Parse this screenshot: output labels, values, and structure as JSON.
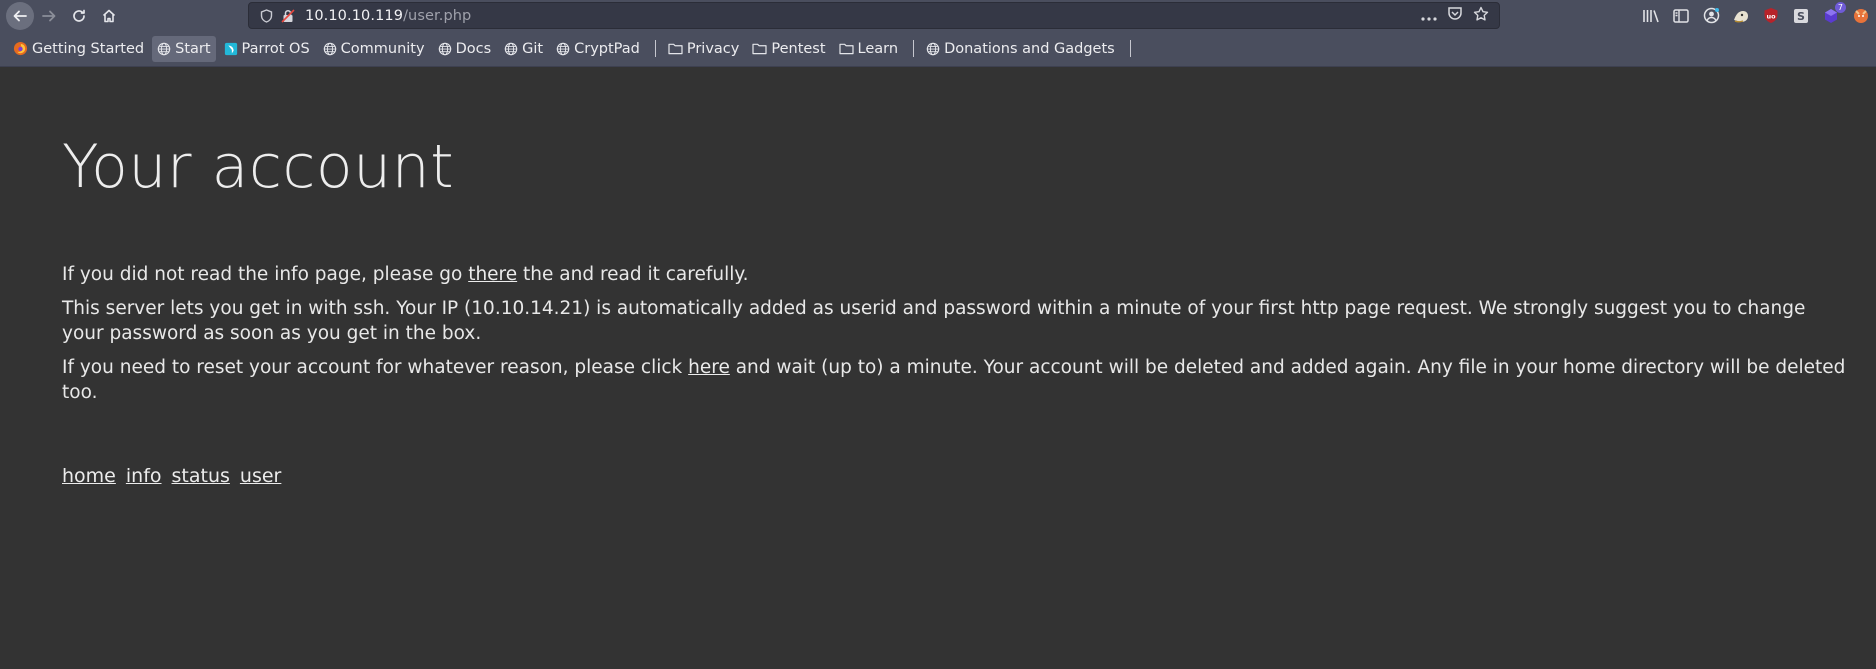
{
  "browser": {
    "url_host": "10.10.10.119",
    "url_path": "/user.php",
    "bookmarks": [
      {
        "label": "Getting Started",
        "icon": "firefox-icon"
      },
      {
        "label": "Start",
        "icon": "globe-icon",
        "active": true
      },
      {
        "label": "Parrot OS",
        "icon": "parrot-icon"
      },
      {
        "label": "Community",
        "icon": "globe-icon"
      },
      {
        "label": "Docs",
        "icon": "globe-icon"
      },
      {
        "label": "Git",
        "icon": "globe-icon"
      },
      {
        "label": "CryptPad",
        "icon": "globe-icon"
      },
      {
        "label": "Privacy",
        "icon": "folder-icon"
      },
      {
        "label": "Pentest",
        "icon": "folder-icon"
      },
      {
        "label": "Learn",
        "icon": "folder-icon"
      },
      {
        "label": "Donations and Gadgets",
        "icon": "globe-icon"
      }
    ],
    "extension_badge": "7"
  },
  "page": {
    "title": "Your account",
    "p1_before": "If you did not read the info page, please go ",
    "p1_link": "there",
    "p1_after": " the and read it carefully.",
    "p2": "This server lets you get in with ssh. Your IP (10.10.14.21) is automatically added as userid and password within a minute of your first http page request. We strongly suggest you to change your password as soon as you get in the box.",
    "p3_before": "If you need to reset your account for whatever reason, please click ",
    "p3_link": "here",
    "p3_after": " and wait (up to) a minute. Your account will be deleted and added again. Any file in your home directory will be deleted too.",
    "nav_links": [
      "home",
      "info",
      "status",
      "user"
    ]
  }
}
